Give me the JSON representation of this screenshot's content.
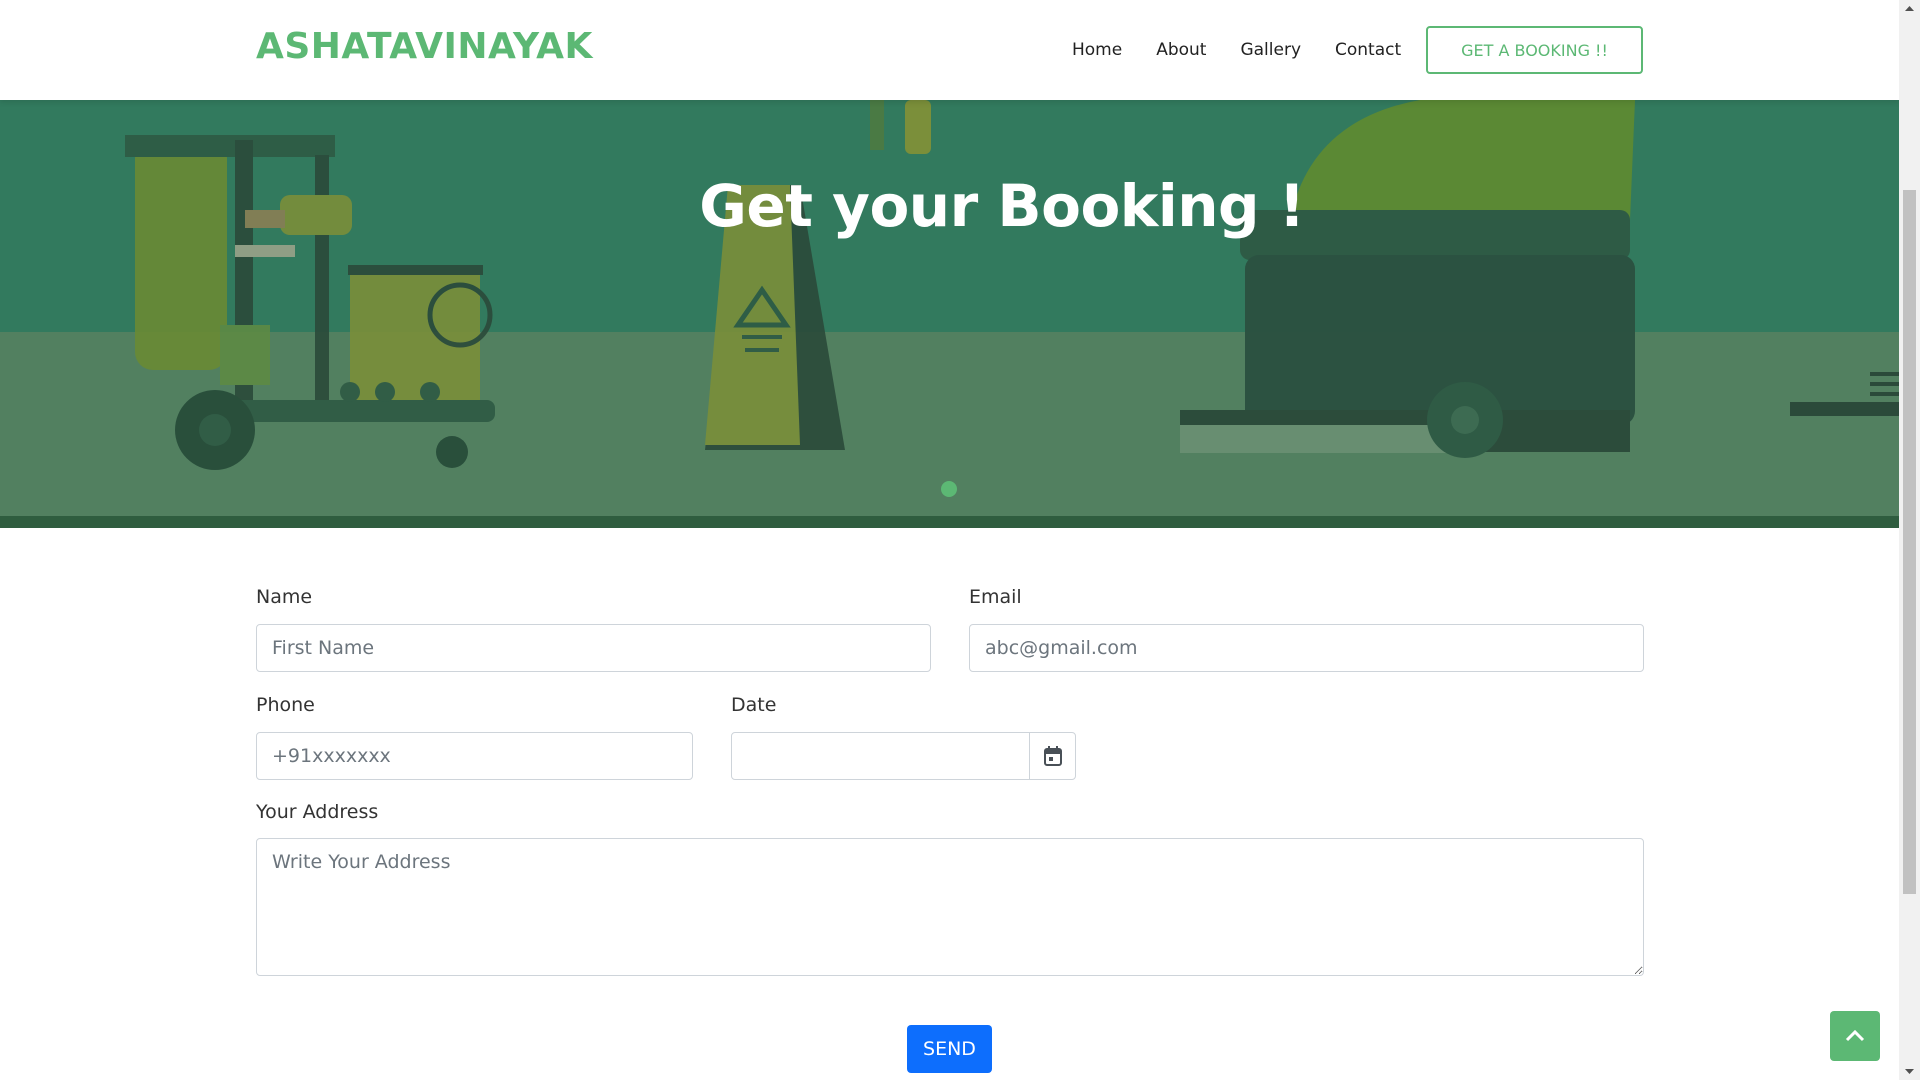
{
  "header": {
    "brand": "ASHATAVINAYAK",
    "nav": [
      {
        "label": "Home"
      },
      {
        "label": "About"
      },
      {
        "label": "Gallery"
      },
      {
        "label": "Contact"
      }
    ],
    "booking_button": "GET A BOOKING !!"
  },
  "hero": {
    "title": "Get your Booking !",
    "slide_indicator_count": 1
  },
  "form": {
    "name": {
      "label": "Name",
      "placeholder": "First Name"
    },
    "email": {
      "label": "Email",
      "placeholder": "abc@gmail.com"
    },
    "phone": {
      "label": "Phone",
      "placeholder": "+91xxxxxxx"
    },
    "date": {
      "label": "Date",
      "value": ""
    },
    "address": {
      "label": "Your Address",
      "placeholder": "Write Your Address"
    },
    "send_label": "SEND"
  },
  "colors": {
    "accent": "#5cb874",
    "hero_bg": "#327a5e",
    "send_button": "#0d6efd"
  },
  "icons": {
    "date_picker": "calendar-icon",
    "back_to_top": "chevron-up-icon"
  }
}
